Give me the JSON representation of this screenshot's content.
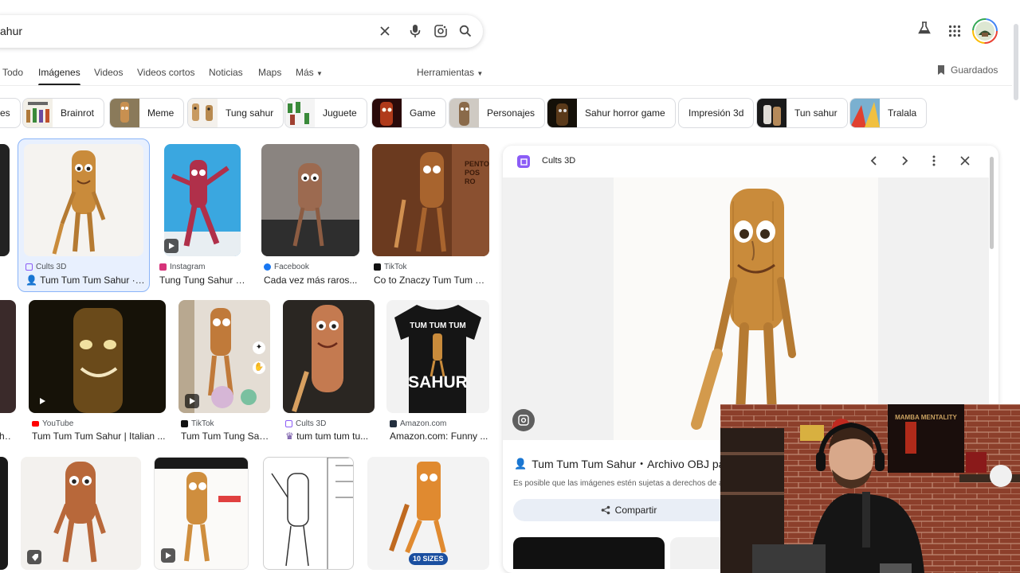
{
  "search": {
    "query": "ahur"
  },
  "tabs": [
    "Todo",
    "Imágenes",
    "Videos",
    "Videos cortos",
    "Noticias",
    "Maps",
    "Más"
  ],
  "tools_label": "Herramientas",
  "saved_label": "Guardados",
  "chips": [
    "es",
    "Brainrot",
    "Meme",
    "Tung sahur",
    "Juguete",
    "Game",
    "Personajes",
    "Sahur horror game",
    "Impresión 3d",
    "Tun sahur",
    "Tralala"
  ],
  "results": [
    {
      "source": "Cults 3D",
      "title": "Tum Tum Tum Sahur · ..."
    },
    {
      "source": "Instagram",
      "title": "Tung Tung Sahur (..."
    },
    {
      "source": "Facebook",
      "title": "Cada vez más raros..."
    },
    {
      "source": "TikTok",
      "title": "Co to Znaczy Tum Tum T..."
    },
    {
      "source": "YouTube",
      "title": "Tum Tum Tum Sahur | Italian ..."
    },
    {
      "source": "TikTok",
      "title": "Tum Tum Tung Sah..."
    },
    {
      "source": "Cults 3D",
      "title": "tum tum tum tu..."
    },
    {
      "source": "Amazon.com",
      "title": "Amazon.com: Funny ..."
    },
    {
      "source": "",
      "title": "h..."
    }
  ],
  "shirt_text": {
    "top": "TUM TUM TUM",
    "bottom": "SAHUR"
  },
  "sign_text": "PENTO POS RO",
  "badge_10_sizes": "10 SIZES",
  "preview": {
    "source": "Cults 3D",
    "title": "Tum Tum Tum Sahur・Archivo OBJ pa",
    "note": "Es posible que las imágenes estén sujetas a derechos de auto",
    "share_label": "Compartir"
  },
  "webcam": {
    "poster_text": "MAMBA MENTALITY"
  },
  "colors": {
    "accent": "#1a73e8",
    "chip_border": "#dadce0",
    "panel_bg": "#f1f1f1",
    "cults": "#8b5cf6"
  }
}
